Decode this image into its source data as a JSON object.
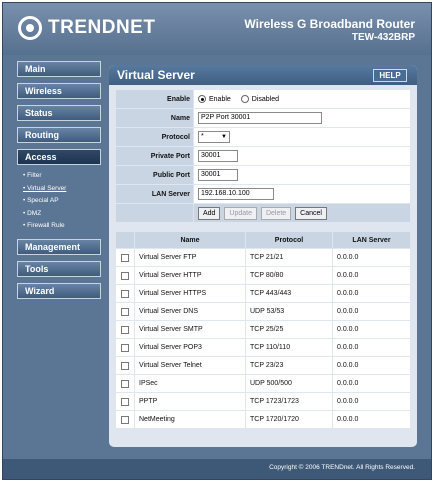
{
  "header": {
    "brand": "TRENDNET",
    "product_title": "Wireless G Broadband Router",
    "model": "TEW-432BRP"
  },
  "nav": {
    "main": "Main",
    "wireless": "Wireless",
    "status": "Status",
    "routing": "Routing",
    "access": "Access",
    "access_sub": [
      "Filter",
      "Virtual Server",
      "Special AP",
      "DMZ",
      "Firewall Rule"
    ],
    "management": "Management",
    "tools": "Tools",
    "wizard": "Wizard"
  },
  "page": {
    "title": "Virtual Server",
    "help": "HELP"
  },
  "form": {
    "enable_label": "Enable",
    "enable_option": "Enable",
    "disabled_option": "Disabled",
    "enable_selected": "Enable",
    "name_label": "Name",
    "name_value": "P2P Port 30001",
    "protocol_label": "Protocol",
    "protocol_value": "*",
    "private_port_label": "Private Port",
    "private_port_value": "30001",
    "public_port_label": "Public Port",
    "public_port_value": "30001",
    "lan_server_label": "LAN Server",
    "lan_server_value": "192.168.10.100",
    "buttons": {
      "add": "Add",
      "update": "Update",
      "delete": "Delete",
      "cancel": "Cancel"
    }
  },
  "table": {
    "headers": [
      "Name",
      "Protocol",
      "LAN Server"
    ],
    "rows": [
      {
        "name": "Virtual Server FTP",
        "protocol": "TCP 21/21",
        "lan": "0.0.0.0"
      },
      {
        "name": "Virtual Server HTTP",
        "protocol": "TCP 80/80",
        "lan": "0.0.0.0"
      },
      {
        "name": "Virtual Server HTTPS",
        "protocol": "TCP 443/443",
        "lan": "0.0.0.0"
      },
      {
        "name": "Virtual Server DNS",
        "protocol": "UDP 53/53",
        "lan": "0.0.0.0"
      },
      {
        "name": "Virtual Server SMTP",
        "protocol": "TCP 25/25",
        "lan": "0.0.0.0"
      },
      {
        "name": "Virtual Server POP3",
        "protocol": "TCP 110/110",
        "lan": "0.0.0.0"
      },
      {
        "name": "Virtual Server Telnet",
        "protocol": "TCP 23/23",
        "lan": "0.0.0.0"
      },
      {
        "name": "IPSec",
        "protocol": "UDP 500/500",
        "lan": "0.0.0.0"
      },
      {
        "name": "PPTP",
        "protocol": "TCP 1723/1723",
        "lan": "0.0.0.0"
      },
      {
        "name": "NetMeeting",
        "protocol": "TCP 1720/1720",
        "lan": "0.0.0.0"
      }
    ]
  },
  "footer": {
    "copyright": "Copyright © 2006 TRENDnet. All Rights Reserved."
  },
  "colors": {
    "frame": "#5b7594",
    "panel": "#dfe6ef",
    "label_cell": "#c9d5e3",
    "nav_active": "#1d3450"
  }
}
